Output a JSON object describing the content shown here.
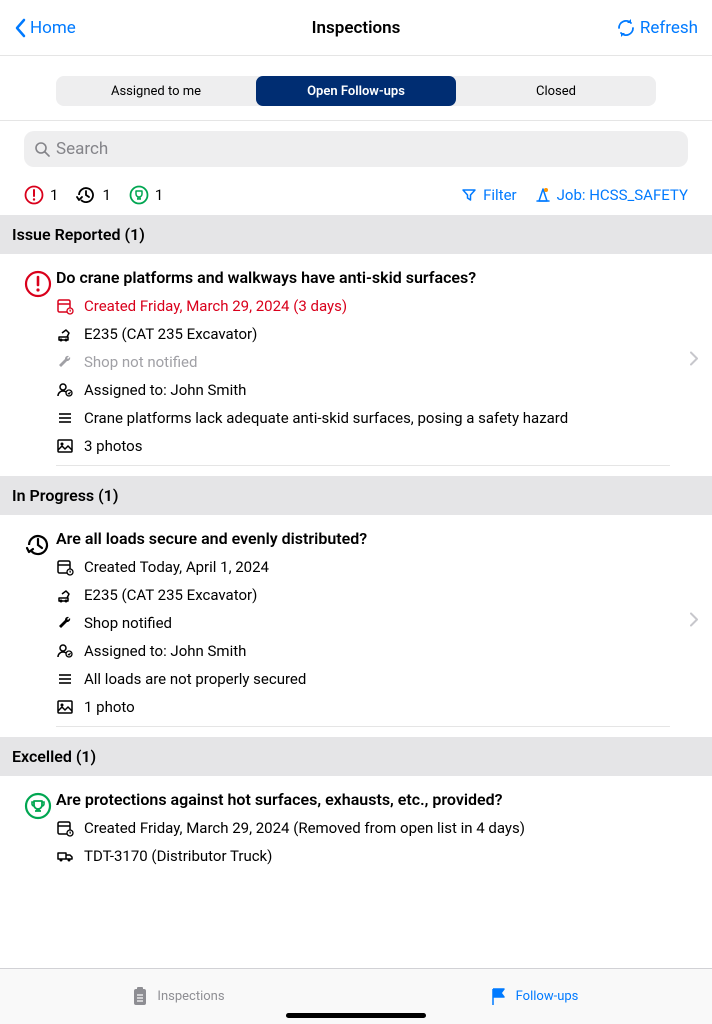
{
  "header": {
    "back_label": "Home",
    "title": "Inspections",
    "refresh_label": "Refresh"
  },
  "segments": {
    "items": [
      "Assigned to me",
      "Open Follow-ups",
      "Closed"
    ],
    "active_index": 1
  },
  "search": {
    "placeholder": "Search"
  },
  "stats": {
    "issue_count": "1",
    "progress_count": "1",
    "excelled_count": "1"
  },
  "filter_label": "Filter",
  "job_label": "Job: HCSS_SAFETY",
  "sections": [
    {
      "title": "Issue Reported (1)",
      "icon": "alert",
      "icon_color": "#d9001b",
      "items": [
        {
          "title": "Do crane platforms and walkways have anti-skid surfaces?",
          "created": "Created Friday, March 29, 2024 (3 days)",
          "created_red": true,
          "equipment": "E235 (CAT 235 Excavator)",
          "shop": "Shop not notified",
          "shop_gray": true,
          "assigned": "Assigned to:  John Smith",
          "notes": "Crane platforms lack adequate anti-skid surfaces, posing a safety hazard",
          "photos": "3 photos"
        }
      ]
    },
    {
      "title": "In Progress (1)",
      "icon": "progress",
      "icon_color": "#000",
      "items": [
        {
          "title": "Are all loads secure and evenly distributed?",
          "created": "Created Today, April 1, 2024",
          "created_red": false,
          "equipment": "E235 (CAT 235 Excavator)",
          "shop": "Shop notified",
          "shop_gray": false,
          "assigned": "Assigned to:  John Smith",
          "notes": "All loads are not properly secured",
          "photos": "1 photo"
        }
      ]
    },
    {
      "title": "Excelled (1)",
      "icon": "trophy",
      "icon_color": "#00a651",
      "items": [
        {
          "title": "Are protections against hot surfaces, exhausts, etc., provided?",
          "created": "Created Friday, March 29, 2024 (Removed from open list in 4 days)",
          "created_red": false,
          "equipment": "TDT-3170 (Distributor Truck)"
        }
      ]
    }
  ],
  "tabbar": {
    "inspections_label": "Inspections",
    "followups_label": "Follow-ups"
  }
}
